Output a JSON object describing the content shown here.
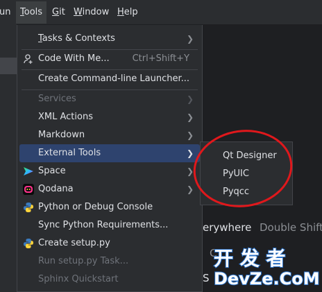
{
  "menubar": {
    "items": [
      "un",
      "Tools",
      "Git",
      "Window",
      "Help"
    ]
  },
  "background_hints": {
    "search_action": "erywhere",
    "search_shortcut": "Double Shift",
    "partial_1": "C",
    "partial_2": "S"
  },
  "menu": {
    "items": [
      {
        "label": "Tasks & Contexts",
        "mnemonic": "T",
        "rest": "asks & Contexts",
        "submenu": true
      },
      {
        "label": "Code With Me...",
        "shortcut": "Ctrl+Shift+Y",
        "icon": "code-with-me-icon"
      },
      {
        "label": "Create Command-line Launcher..."
      },
      {
        "label": "Services",
        "disabled": true,
        "submenu": true
      },
      {
        "label": "XML Actions",
        "submenu": true
      },
      {
        "label": "Markdown",
        "submenu": true
      },
      {
        "label": "External Tools",
        "submenu": true,
        "selected": true
      },
      {
        "label": "Space",
        "submenu": true,
        "icon": "space-icon"
      },
      {
        "label": "Qodana",
        "submenu": true,
        "icon": "qodana-icon"
      },
      {
        "label": "Python or Debug Console",
        "icon": "python-icon"
      },
      {
        "label": "Sync Python Requirements..."
      },
      {
        "label": "Create setup.py",
        "icon": "python-icon"
      },
      {
        "label": "Run setup.py Task...",
        "disabled": true
      },
      {
        "label": "Sphinx Quickstart",
        "disabled": true
      }
    ]
  },
  "submenu": {
    "items": [
      "Qt Designer",
      "PyUIC",
      "Pyqcc"
    ]
  },
  "watermark": {
    "line1": "开 发 者",
    "line2": "DevZe.CoM"
  },
  "colors": {
    "menubar_bg": "#2b2d30",
    "menu_bg": "#2b2d30",
    "selection": "#2e436e",
    "annotation": "#e0181c",
    "watermark_fill": "#ffffff",
    "watermark_outline": "#2a72c9"
  }
}
